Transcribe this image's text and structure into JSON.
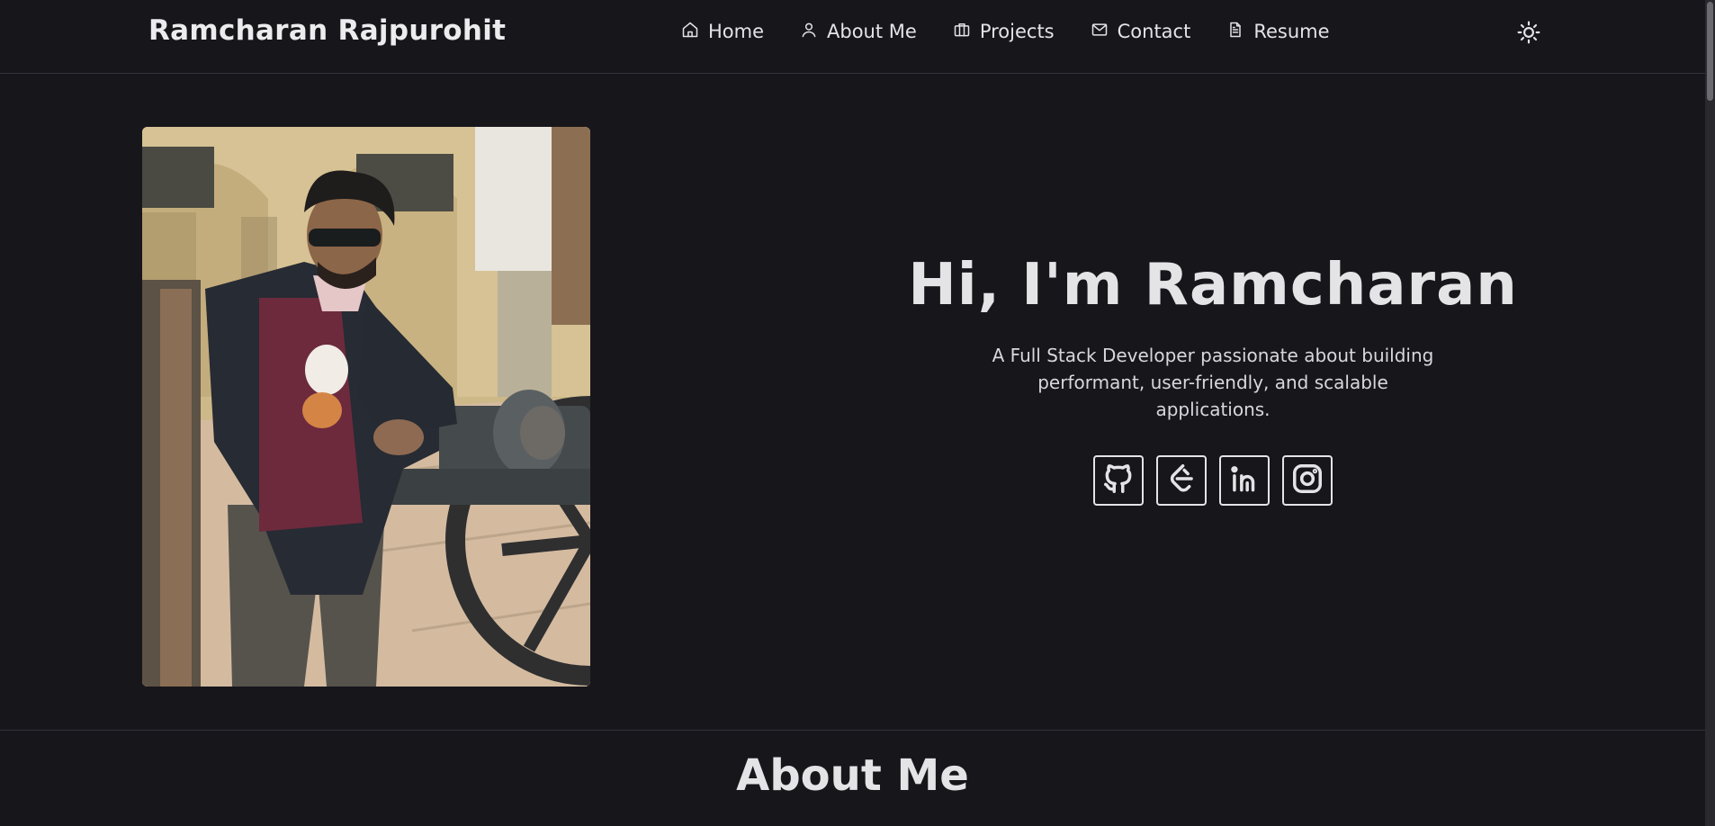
{
  "brand": "Ramcharan Rajpurohit",
  "nav": {
    "items": [
      {
        "label": "Home",
        "icon": "home-icon"
      },
      {
        "label": "About Me",
        "icon": "user-icon"
      },
      {
        "label": "Projects",
        "icon": "briefcase-icon"
      },
      {
        "label": "Contact",
        "icon": "mail-icon"
      },
      {
        "label": "Resume",
        "icon": "document-icon"
      }
    ],
    "theme_toggle_icon": "sun-icon"
  },
  "hero": {
    "title": "Hi, I'm Ramcharan",
    "subtitle": "A Full Stack Developer passionate about building performant, user-friendly, and scalable applications.",
    "photo_alt": "Photo of Ramcharan leaning on a cannon",
    "socials": [
      {
        "name": "GitHub",
        "icon": "github-icon"
      },
      {
        "name": "LeetCode",
        "icon": "leetcode-icon"
      },
      {
        "name": "LinkedIn",
        "icon": "linkedin-icon"
      },
      {
        "name": "Instagram",
        "icon": "instagram-icon"
      }
    ]
  },
  "about": {
    "title": "About Me"
  },
  "colors": {
    "background": "#17161b",
    "text": "#e4e4e7",
    "border": "#34333a"
  }
}
